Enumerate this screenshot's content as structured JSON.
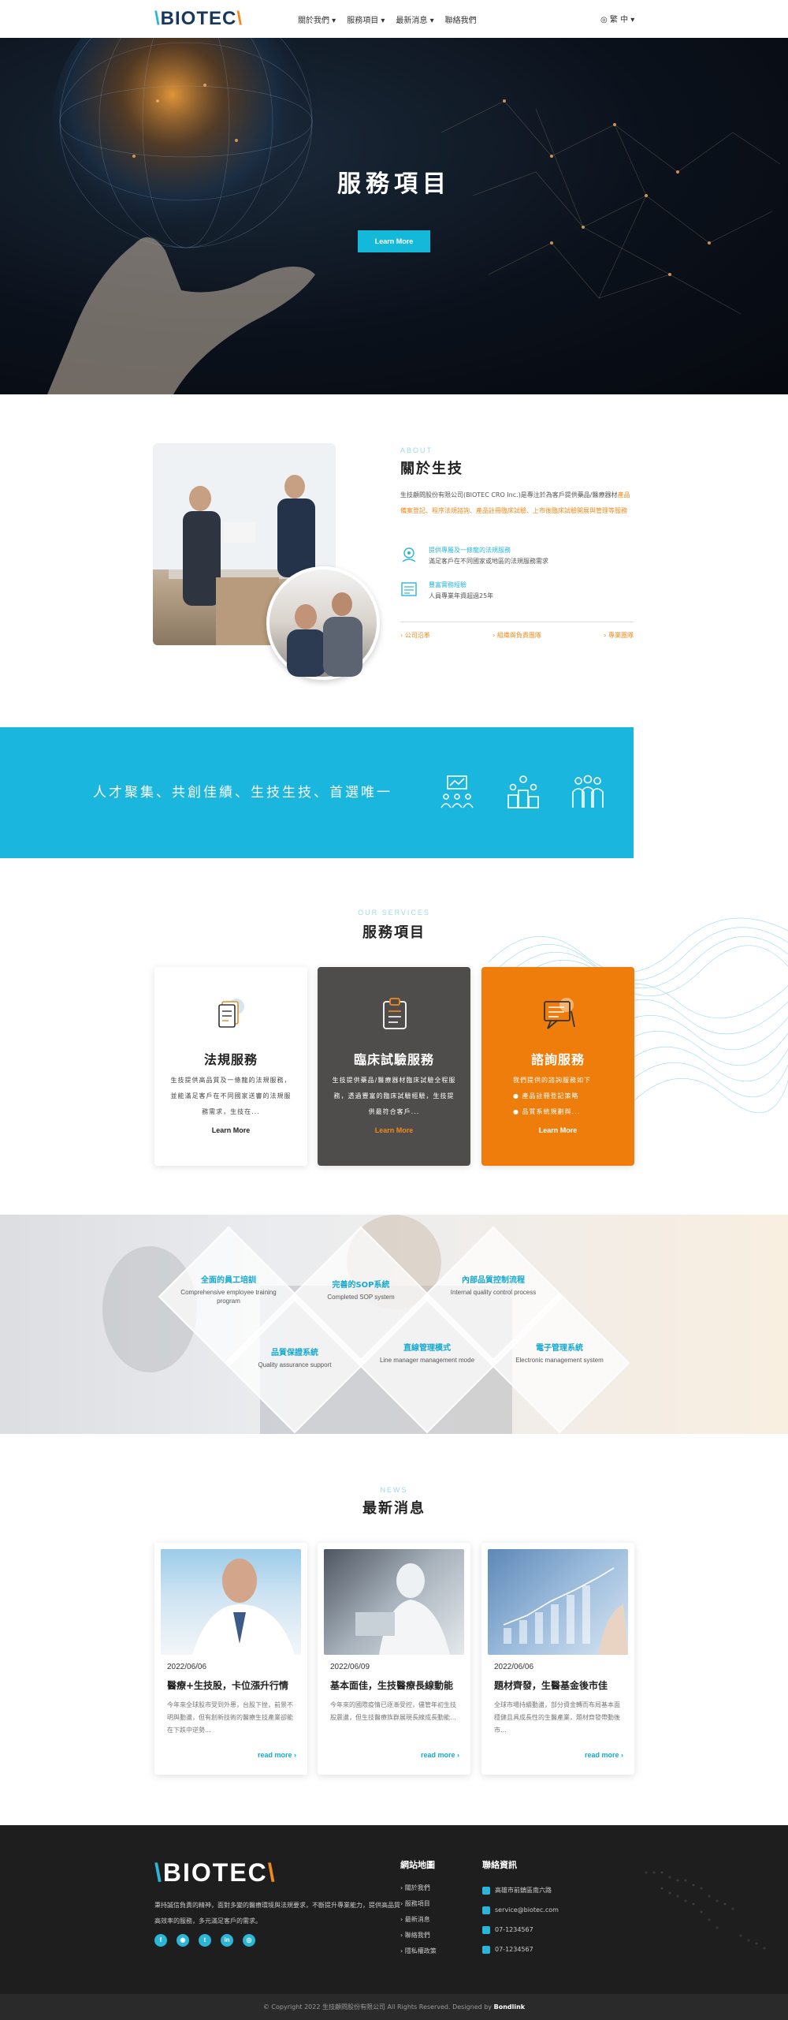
{
  "header": {
    "logo_slash_left": "\\",
    "logo_text": "BIOTEC",
    "logo_slash_right": "\\",
    "nav": [
      "關於我們 ▾",
      "服務項目 ▾",
      "最新消息 ▾",
      "聯絡我們"
    ],
    "lang": "◎ 繁 中 ▾"
  },
  "hero": {
    "title": "服務項目",
    "button": "Learn More"
  },
  "about": {
    "label": "ABOUT",
    "title": "關於生技",
    "text_1": "生技顧問股份有限公司(BIOTEC CRO Inc.)是專注於為客戶提供藥品/醫療器材",
    "text_hl_1": "產品備案登記、程序法規諮詢、產品註冊臨床試驗、上市後臨床試驗開展與管理等服務",
    "features": [
      {
        "icon": "target-icon",
        "title": "提供專屬及一條龍的法規服務",
        "desc": "滿足客戶在不同國家或地區的法規服務需求"
      },
      {
        "icon": "document-icon",
        "title": "豐富實務經驗",
        "desc": "人員專業年資超過25年"
      }
    ],
    "links": [
      "› 公司沿革",
      "› 組織與負責團隊",
      "› 專業團隊"
    ]
  },
  "banner": {
    "text": "人才聚集、共創佳績、生技生技、首選唯一"
  },
  "services": {
    "label": "OUR SERVICES",
    "title": "服務項目",
    "cards": [
      {
        "title": "法規服務",
        "desc": "生技提供高品質及一條龍的法規服務，並能滿足客戶在不同國家送審的法規服務需求，生技在...",
        "more": "Learn More"
      },
      {
        "title": "臨床試驗服務",
        "desc": "生技提供藥品/醫療器材臨床試驗全程服務，透過豐富的臨床試驗經驗，生技提供最符合客戶...",
        "more": "Learn More"
      },
      {
        "title": "諮詢服務",
        "desc_intro": "我們提供的諮詢服務如下",
        "bullets": [
          "產品註冊登記策略",
          "品質系統規劃與..."
        ],
        "more": "Learn More"
      }
    ]
  },
  "quality": [
    {
      "zh": "全面的員工培訓",
      "en": "Comprehensive employee training program"
    },
    {
      "zh": "完善的SOP系統",
      "en": "Completed SOP system"
    },
    {
      "zh": "內部品質控制流程",
      "en": "Internal quality control process"
    },
    {
      "zh": "品質保證系統",
      "en": "Quality assurance support"
    },
    {
      "zh": "直線管理模式",
      "en": "Line manager management mode"
    },
    {
      "zh": "電子管理系統",
      "en": "Electronic management system"
    }
  ],
  "news": {
    "label": "NEWS",
    "title": "最新消息",
    "items": [
      {
        "date": "2022/06/06",
        "title": "醫療+生技股，卡位漲升行情",
        "desc": "今年來全球股市受到外患，台股下挫，前景不明與動盪，但有創新技術的醫療生技產業卻能在下跌中逆勢...",
        "more": "read more ›"
      },
      {
        "date": "2022/06/09",
        "title": "基本面佳，生技醫療長線動能",
        "desc": "今年來的國際疫情已逐漸受控，儘管年初生技股震盪，但生技醫療族群展現長線成長動能…",
        "more": "read more ›"
      },
      {
        "date": "2022/06/06",
        "title": "題材齊發，生醫基金後市佳",
        "desc": "全球市場持續動盪，部分資金轉而布局基本面穩健且具成長性的生醫產業，題材齊發帶動後市…",
        "more": "read more ›"
      }
    ]
  },
  "footer": {
    "logo_slash_left": "\\",
    "logo_text": "BIOTEC",
    "logo_slash_right": "\\",
    "desc": "秉持誠信負責的精神，面對多變的醫療環境與法規要求，不斷提升專業能力，提供高品質高效率的服務，多元滿足客戶的需求。",
    "social": [
      "f",
      "◉",
      "t",
      "in",
      "◎"
    ],
    "sitemap_title": "網站地圖",
    "sitemap": [
      "› 關於我們",
      "› 服務項目",
      "› 最新消息",
      "› 聯絡我們",
      "› 隱私權政策"
    ],
    "contact_title": "聯絡資訊",
    "contact": [
      "高雄市前鎮區南六路",
      "service@biotec.com",
      "07-1234567",
      "07-1234567"
    ],
    "copyright": "© Copyright 2022 生技顧問股份有限公司 All Rights Reserved. Designed by",
    "designer": "Bondlink"
  }
}
